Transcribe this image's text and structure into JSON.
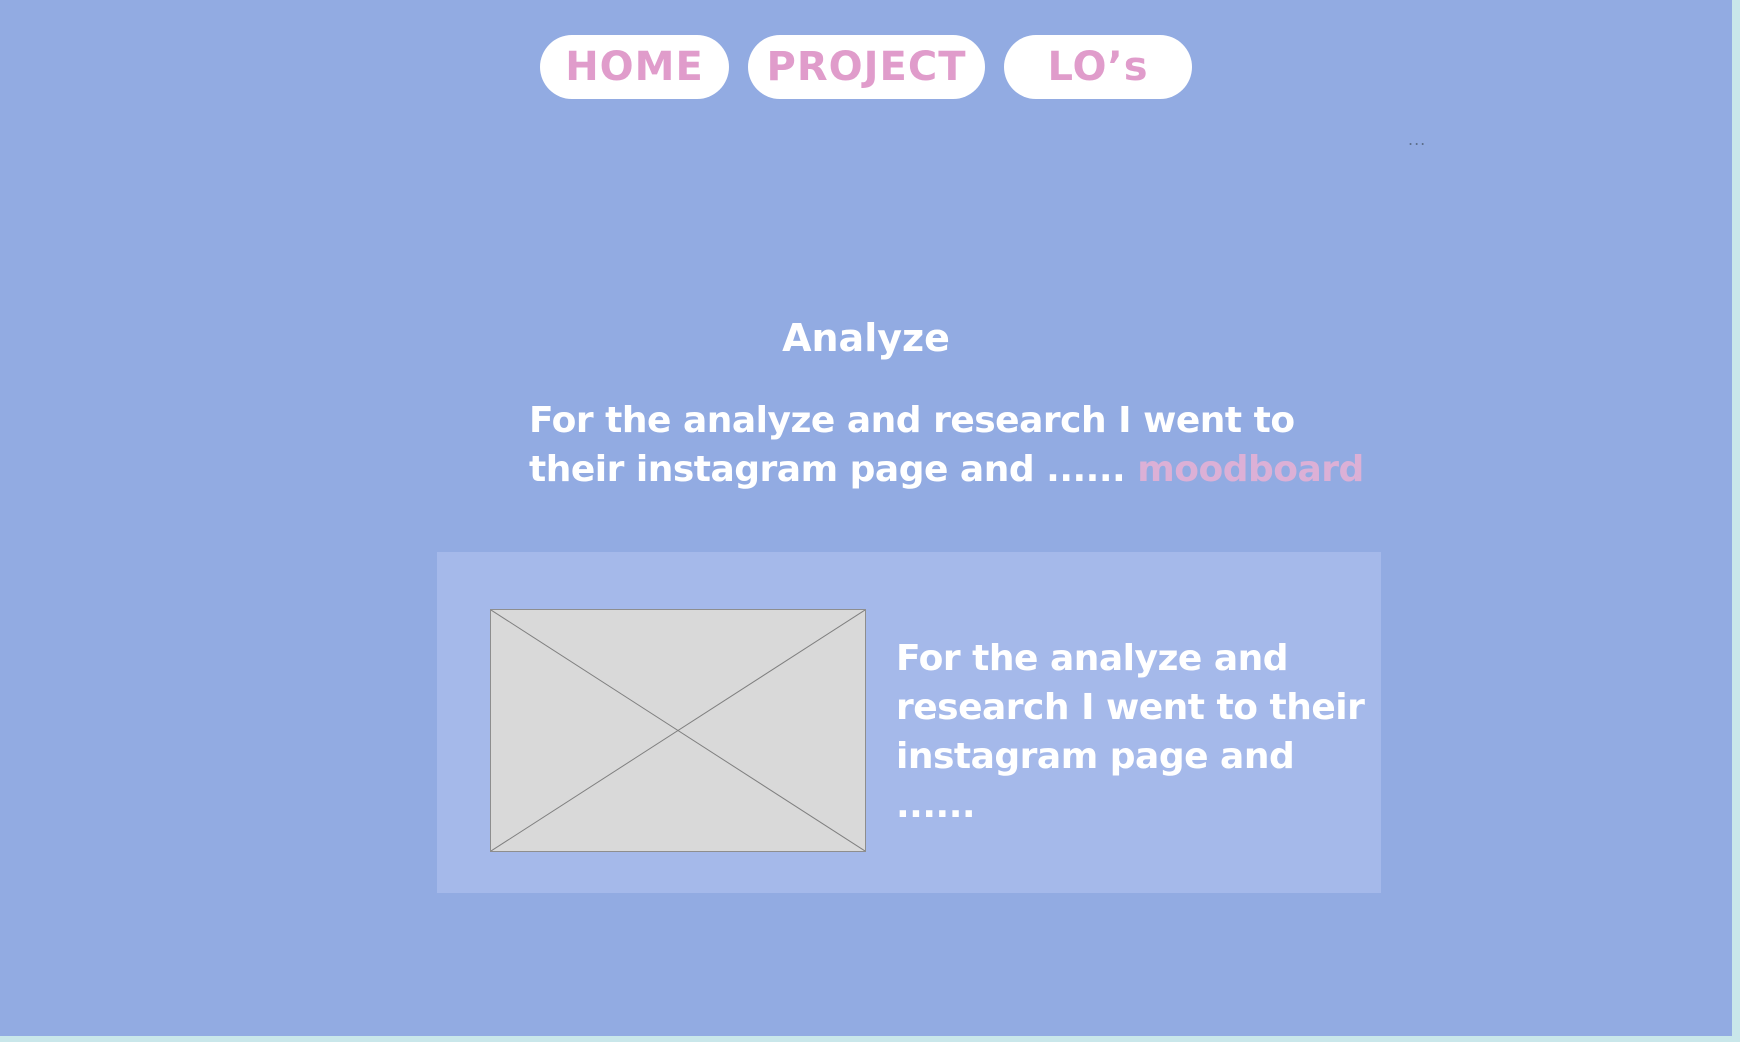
{
  "nav": {
    "home": "HOME",
    "project": "PROJECT",
    "los": "LO’s"
  },
  "more_menu": "...",
  "section": {
    "title": "Analyze",
    "intro_line1": "For the analyze and research I went to",
    "intro_line2": "their instagram page and ...... ",
    "intro_link": "moodboard"
  },
  "card": {
    "image_icon": "image-placeholder-icon",
    "text_line1": "For the analyze and",
    "text_line2": "research I went to their",
    "text_line3": "instagram page and ......"
  },
  "colors": {
    "background": "#92abe2",
    "card": "#a5b9ea",
    "nav_text": "#e09ccb",
    "link": "#dcb0d6",
    "text": "#ffffff"
  }
}
